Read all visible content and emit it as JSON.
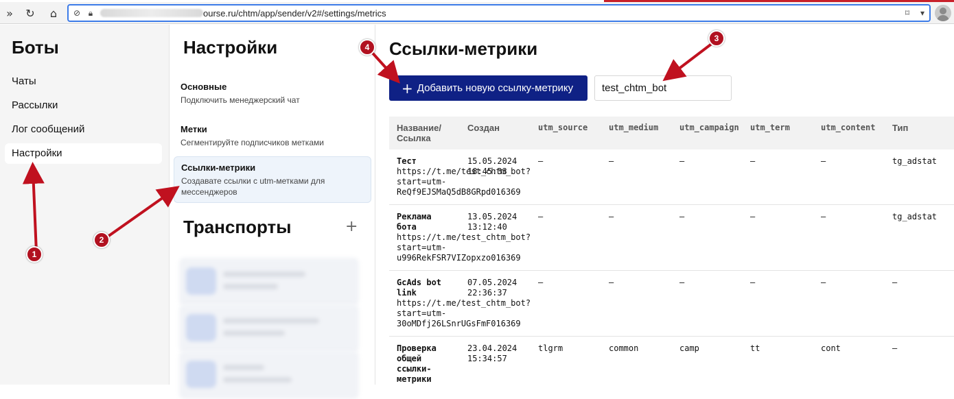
{
  "browser": {
    "url": "ourse.ru/chtm/app/sender/v2#/settings/metrics",
    "icons": [
      "sidebar-toggle-icon",
      "reload-icon",
      "home-icon",
      "shield-icon",
      "lock-icon",
      "bookmark-icon",
      "chevron-down-icon",
      "profile-icon"
    ]
  },
  "nav": {
    "title": "Боты",
    "items": [
      {
        "label": "Чаты"
      },
      {
        "label": "Рассылки"
      },
      {
        "label": "Лог сообщений"
      },
      {
        "label": "Настройки",
        "active": true
      }
    ]
  },
  "settings": {
    "title": "Настройки",
    "items": [
      {
        "title": "Основные",
        "desc": "Подключить менеджерский чат"
      },
      {
        "title": "Метки",
        "desc": "Сегментируйте подписчиков метками"
      },
      {
        "title": "Ссылки-метрики",
        "desc": "Создавате ссылки с utm-метками для мессенджеров",
        "active": true
      }
    ],
    "transports_title": "Транспорты",
    "add_transport": "+"
  },
  "main": {
    "title": "Ссылки-метрики",
    "add_button": "Добавить новую ссылку-метрику",
    "search_value": "test_chtm_bot",
    "columns": [
      "Название/ Ссылка",
      "Создан",
      "utm_source",
      "utm_medium",
      "utm_campaign",
      "utm_term",
      "utm_content",
      "Тип"
    ],
    "rows": [
      {
        "name": "Тест",
        "created": "15.05.2024\n18:45:33",
        "link": "https://t.me/test_chtm_bot?\nstart=utm-\nReQf9EJSMaQ5dB8GRpd016369",
        "utm_source": "–",
        "utm_medium": "–",
        "utm_campaign": "–",
        "utm_term": "–",
        "utm_content": "–",
        "type": "tg_adstat"
      },
      {
        "name": "Реклама\nбота",
        "created": "13.05.2024\n13:12:40",
        "link": "https://t.me/test_chtm_bot?\nstart=utm-\nu996RekFSR7VIZopxzo016369",
        "utm_source": "–",
        "utm_medium": "–",
        "utm_campaign": "–",
        "utm_term": "–",
        "utm_content": "–",
        "type": "tg_adstat"
      },
      {
        "name": "GcAds bot\nlink",
        "created": "07.05.2024\n22:36:37",
        "link": "https://t.me/test_chtm_bot?\nstart=utm-\n30oMDfj26LSnrUGsFmF016369",
        "utm_source": "–",
        "utm_medium": "–",
        "utm_campaign": "–",
        "utm_term": "–",
        "utm_content": "–",
        "type": "–"
      },
      {
        "name": "Проверка\nобщей\nссылки-\nметрики",
        "created": "23.04.2024\n15:34:57",
        "link": "",
        "utm_source": "tlgrm",
        "utm_medium": "common",
        "utm_campaign": "camp",
        "utm_term": "tt",
        "utm_content": "cont",
        "type": "–"
      }
    ]
  },
  "annotations": {
    "badges": [
      "1",
      "2",
      "3",
      "4"
    ],
    "color": "#b11120"
  }
}
